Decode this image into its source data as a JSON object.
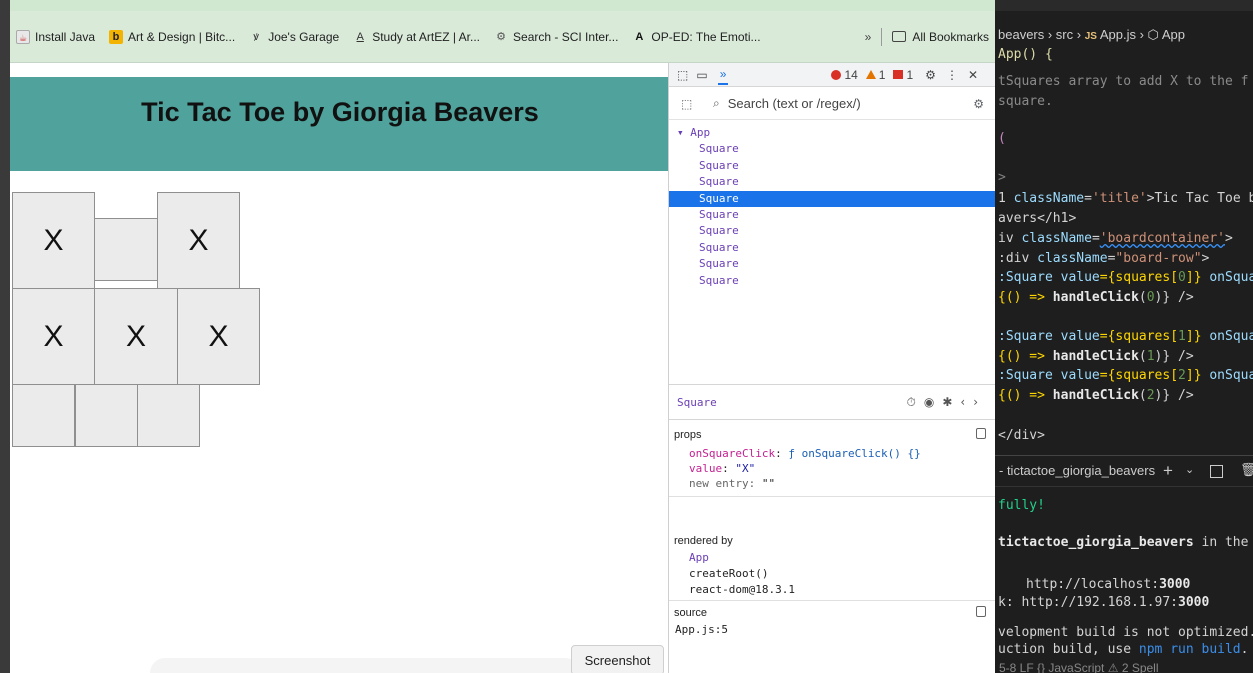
{
  "bookmarks": [
    {
      "icon": "java-icon",
      "glyph": "☕",
      "label": "Install Java"
    },
    {
      "icon": "behance-icon",
      "glyph": "b",
      "label": "Art & Design | Bitc..."
    },
    {
      "icon": "joes-garage-icon",
      "glyph": "ꝟ",
      "label": "Joe's Garage"
    },
    {
      "icon": "artez-icon",
      "glyph": "A",
      "label": "Study at ArtEZ | Ar..."
    },
    {
      "icon": "sci-icon",
      "glyph": "⚙",
      "label": "Search - SCI Inter..."
    },
    {
      "icon": "opa-icon",
      "glyph": "A",
      "label": "OP-ED: The Emoti..."
    }
  ],
  "bookmarks_more": "»",
  "all_bookmarks": "All Bookmarks",
  "app": {
    "title": "Tic Tac Toe by Giorgia Beavers",
    "squares": [
      "X",
      "",
      "X",
      "X",
      "X",
      "X",
      "",
      "",
      ""
    ],
    "title_bar_color": "#4fa39c"
  },
  "tooltip": "Screenshot",
  "devtools": {
    "more_tabs": "»",
    "errors": "14",
    "warnings": "1",
    "issues": "1",
    "search_placeholder": "Search (text or /regex/)",
    "tree_root": "App",
    "tree_items": [
      "Square",
      "Square",
      "Square",
      "Square",
      "Square",
      "Square",
      "Square",
      "Square",
      "Square"
    ],
    "selected_index": 3,
    "selected_component": "Square",
    "props_header": "props",
    "props": {
      "onSquareClick_key": "onSquareClick",
      "onSquareClick_val": "ƒ onSquareClick() {}",
      "value_key": "value",
      "value_val": "\"X\"",
      "new_entry_key": "new entry",
      "new_entry_val": "\"\""
    },
    "rendered_by_header": "rendered by",
    "rendered_by": [
      "App",
      "createRoot()",
      "react-dom@18.3.1"
    ],
    "source_header": "source",
    "source": "App.js:5"
  },
  "editor": {
    "breadcrumb_path": "beavers › src ›",
    "breadcrumb_js": "JS",
    "breadcrumb_file": "App.js ›",
    "breadcrumb_fn": "App",
    "lines": {
      "l1": "App() {",
      "l2": "tSquares array to add X to the f",
      "l3": "square.",
      "l4": "(",
      "l5": ">",
      "l6a": "1 ",
      "l6b": "className",
      "l6c": "=",
      "l6d": "'title'",
      "l6e": ">Tic Tac Toe b",
      "l7": "avers</h1>",
      "l8a": "iv ",
      "l8b": "className",
      "l8c": "=",
      "l8d": "'boardcontainer'",
      "l8e": ">",
      "l9a": ":div ",
      "l9b": "className",
      "l9c": "=",
      "l9d": "\"board-row\"",
      "l9e": ">",
      "l10a": ":Square ",
      "l10b": "value",
      "l10c": "={squares[",
      "l10d": "0",
      "l10e": "]} ",
      "l10f": "onSqua",
      "l11a": "{() => ",
      "l11b": "handleClick",
      "l11c": "(",
      "l11d": "0",
      "l11e": ")} />",
      "l12a": ":Square ",
      "l12b": "value",
      "l12c": "={squares[",
      "l12d": "1",
      "l12e": "]} ",
      "l12f": "onSqua",
      "l13a": "{() => ",
      "l13b": "handleClick",
      "l13c": "(",
      "l13d": "1",
      "l13e": ")} />",
      "l14a": ":Square ",
      "l14b": "value",
      "l14c": "={squares[",
      "l14d": "2",
      "l14e": "]} ",
      "l14f": "onSqua",
      "l15a": "{() => ",
      "l15b": "handleClick",
      "l15c": "(",
      "l15d": "2",
      "l15e": ")} />",
      "l16": "</div>"
    },
    "terminal_label": "- tictactoe_giorgia_beavers",
    "terminal": {
      "t1": "fully!",
      "t2a": "tictactoe_giorgia_beavers",
      "t2b": " in the b",
      "t3a": "http://localhost:",
      "t3b": "3000",
      "t4a": "k:  http://192.168.1.97:",
      "t4b": "3000",
      "t5": "velopment build is not optimized.",
      "t6a": "uction build, use ",
      "t6b": "npm run build",
      "t6c": ".",
      "t7": "5-8   LF  {}  JavaScript  ⚠ 2 Spell"
    }
  }
}
